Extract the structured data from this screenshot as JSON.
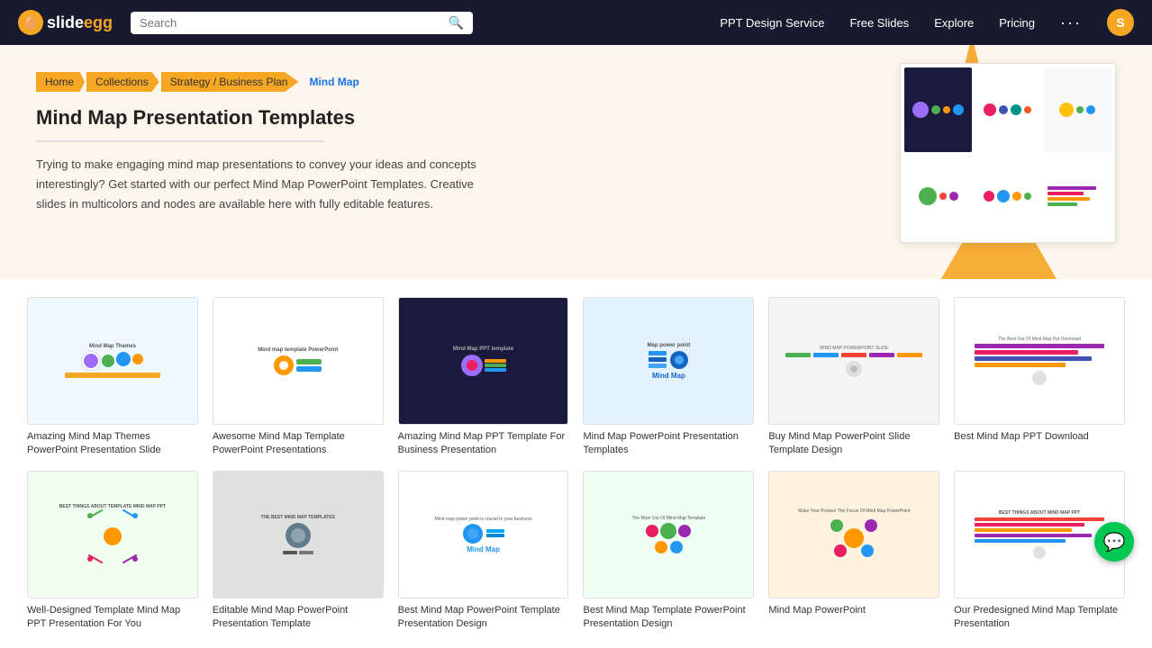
{
  "logo": {
    "icon": "S",
    "text_pre": "slide",
    "text_highlight": "egg"
  },
  "search": {
    "placeholder": "Search"
  },
  "nav": {
    "links": [
      {
        "label": "PPT Design Service",
        "id": "ppt-design"
      },
      {
        "label": "Free Slides",
        "id": "free-slides"
      },
      {
        "label": "Explore",
        "id": "explore"
      },
      {
        "label": "Pricing",
        "id": "pricing"
      }
    ],
    "avatar_letter": "S"
  },
  "breadcrumb": [
    {
      "label": "Home",
      "active": false
    },
    {
      "label": "Collections",
      "active": false
    },
    {
      "label": "Strategy / Business Plan",
      "active": false
    },
    {
      "label": "Mind Map",
      "active": true
    }
  ],
  "hero": {
    "title": "Mind Map Presentation Templates",
    "description": "Trying to make engaging mind map presentations to convey your ideas and concepts interestingly? Get started with our perfect Mind Map PowerPoint Templates. Creative slides in multicolors and nodes are available here with fully editable features."
  },
  "templates_row1": [
    {
      "id": "t1",
      "title": "Amazing Mind Map Themes PowerPoint Presentation Slide",
      "thumb_label": "Mind Map Themes",
      "theme": "light"
    },
    {
      "id": "t2",
      "title": "Awesome Mind Map Template PowerPoint Presentations",
      "thumb_label": "Mind map template PowerPoint",
      "theme": "light"
    },
    {
      "id": "t3",
      "title": "Amazing Mind Map PPT Template For Business Presentation",
      "thumb_label": "Mind Map PPT template",
      "theme": "dark"
    },
    {
      "id": "t4",
      "title": "Mind Map PowerPoint Presentation Templates",
      "thumb_label": "Map power point is crucial to your business",
      "theme": "blue"
    },
    {
      "id": "t5",
      "title": "Buy Mind Map PowerPoint Slide Template Design",
      "thumb_label": "MIND MAP POWERPOINT SLIDE",
      "theme": "light"
    },
    {
      "id": "t6",
      "title": "Best Mind Map PPT Download",
      "thumb_label": "The Best Out Of Mind Map Ppt Download",
      "theme": "light"
    }
  ],
  "templates_row2": [
    {
      "id": "t7",
      "title": "Well-Designed Template Mind Map PPT Presentation For You",
      "thumb_label": "Best things about template mind map ppt",
      "theme": "light"
    },
    {
      "id": "t8",
      "title": "Editable Mind Map PowerPoint Presentation Template",
      "thumb_label": "The best mind map templates",
      "theme": "gray"
    },
    {
      "id": "t9",
      "title": "Best Mind Map PowerPoint Template Presentation Design",
      "thumb_label": "Mind map power point is crucial to your business",
      "theme": "white"
    },
    {
      "id": "t10",
      "title": "Best Mind Map Template PowerPoint Presentation Design",
      "thumb_label": "The Most Out Of Mind Map Template Presentation",
      "theme": "light2"
    },
    {
      "id": "t11",
      "title": "Mind Map PowerPoint",
      "thumb_label": "Make Your Product The Focus Of Mind Map PowerPoint",
      "theme": "white"
    },
    {
      "id": "t12",
      "title": "Our Predesigned Mind Map Template Presentation",
      "thumb_label": "Best things about mind map ppt",
      "theme": "light"
    }
  ]
}
